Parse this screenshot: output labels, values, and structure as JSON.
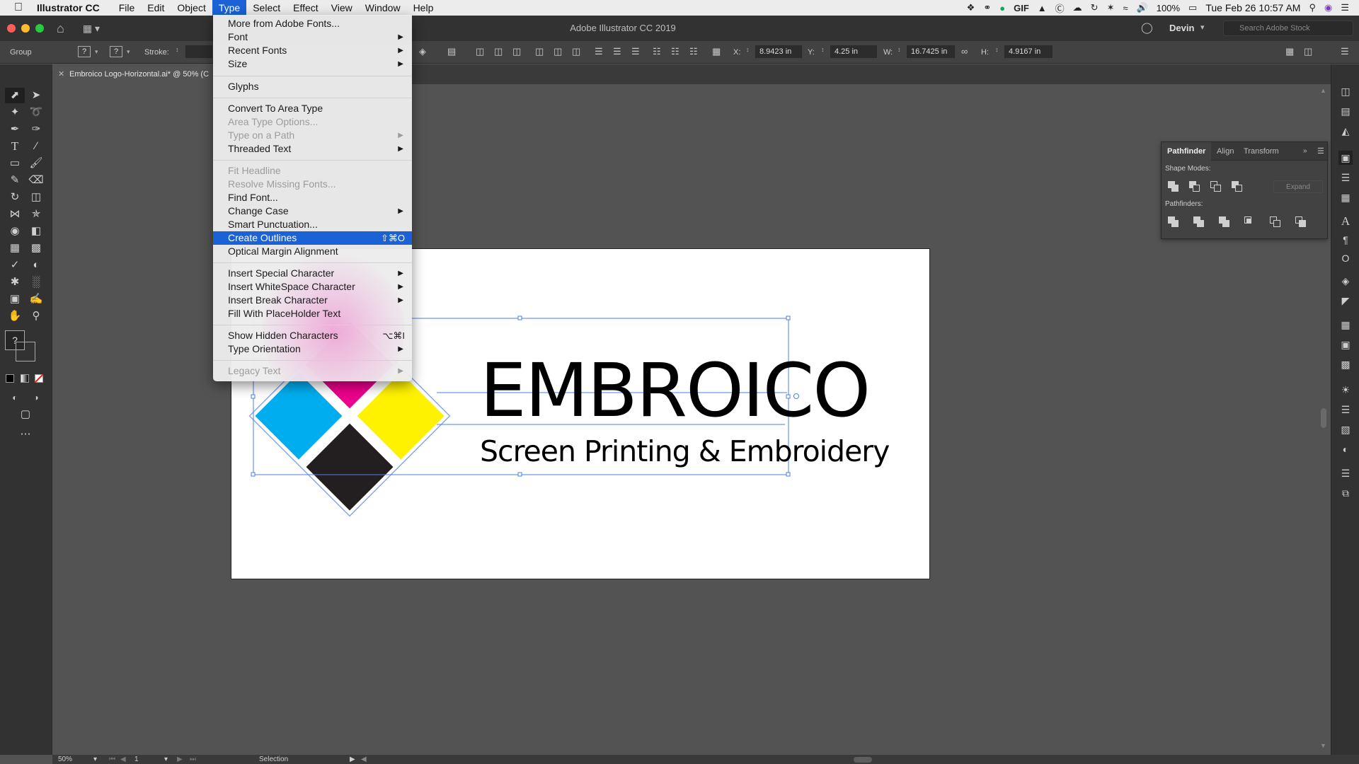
{
  "menubar": {
    "app_name": "Illustrator CC",
    "items": [
      "File",
      "Edit",
      "Object",
      "Type",
      "Select",
      "Effect",
      "View",
      "Window",
      "Help"
    ],
    "active_item": "Type",
    "battery": "100%",
    "datetime": "Tue Feb 26  10:57 AM",
    "gif_label": "GIF"
  },
  "titlebar": {
    "title": "Adobe Illustrator CC 2019",
    "user": "Devin",
    "search_placeholder": "Search Adobe Stock"
  },
  "controlbar": {
    "selection_type": "Group",
    "fill_unknown": "?",
    "stroke_unknown": "?",
    "stroke_label": "Stroke:",
    "x_label": "X:",
    "x_value": "8.9423 in",
    "y_label": "Y:",
    "y_value": "4.25 in",
    "w_label": "W:",
    "w_value": "16.7425 in",
    "h_label": "H:",
    "h_value": "4.9167 in"
  },
  "document": {
    "tab_title": "Embroico Logo-Horizontal.ai* @ 50% (C"
  },
  "artwork": {
    "title": "EMBROICO",
    "subtitle": "Screen Printing & Embroidery",
    "colors": {
      "cyan": "#00aeef",
      "magenta": "#ec008c",
      "yellow": "#fff200",
      "black": "#231f20",
      "selection": "#4a7fe8"
    }
  },
  "type_menu": {
    "items": [
      {
        "label": "More from Adobe Fonts...",
        "enabled": true
      },
      {
        "label": "Font",
        "enabled": true,
        "submenu": true
      },
      {
        "label": "Recent Fonts",
        "enabled": true,
        "submenu": true
      },
      {
        "label": "Size",
        "enabled": true,
        "submenu": true
      },
      {
        "label": "Glyphs",
        "enabled": true
      },
      {
        "label": "Convert To Area Type",
        "enabled": true
      },
      {
        "label": "Area Type Options...",
        "enabled": false
      },
      {
        "label": "Type on a Path",
        "enabled": false,
        "submenu": true
      },
      {
        "label": "Threaded Text",
        "enabled": true,
        "submenu": true
      },
      {
        "label": "Fit Headline",
        "enabled": false
      },
      {
        "label": "Resolve Missing Fonts...",
        "enabled": false
      },
      {
        "label": "Find Font...",
        "enabled": true
      },
      {
        "label": "Change Case",
        "enabled": true,
        "submenu": true
      },
      {
        "label": "Smart Punctuation...",
        "enabled": true
      },
      {
        "label": "Create Outlines",
        "enabled": true,
        "highlighted": true,
        "shortcut": "⇧⌘O"
      },
      {
        "label": "Optical Margin Alignment",
        "enabled": true
      },
      {
        "label": "Insert Special Character",
        "enabled": true,
        "submenu": true
      },
      {
        "label": "Insert WhiteSpace Character",
        "enabled": true,
        "submenu": true
      },
      {
        "label": "Insert Break Character",
        "enabled": true,
        "submenu": true
      },
      {
        "label": "Fill With PlaceHolder Text",
        "enabled": true
      },
      {
        "label": "Show Hidden Characters",
        "enabled": true,
        "shortcut": "⌥⌘I"
      },
      {
        "label": "Type Orientation",
        "enabled": true,
        "submenu": true
      },
      {
        "label": "Legacy Text",
        "enabled": false,
        "submenu": true
      }
    ]
  },
  "pathfinder": {
    "tabs": [
      "Pathfinder",
      "Align",
      "Transform"
    ],
    "shape_modes_label": "Shape Modes:",
    "pathfinders_label": "Pathfinders:",
    "expand_label": "Expand"
  },
  "toolbar": {
    "unknown_fill": "?"
  },
  "statusbar": {
    "zoom": "50%",
    "artboard_number": "1",
    "tool": "Selection"
  }
}
